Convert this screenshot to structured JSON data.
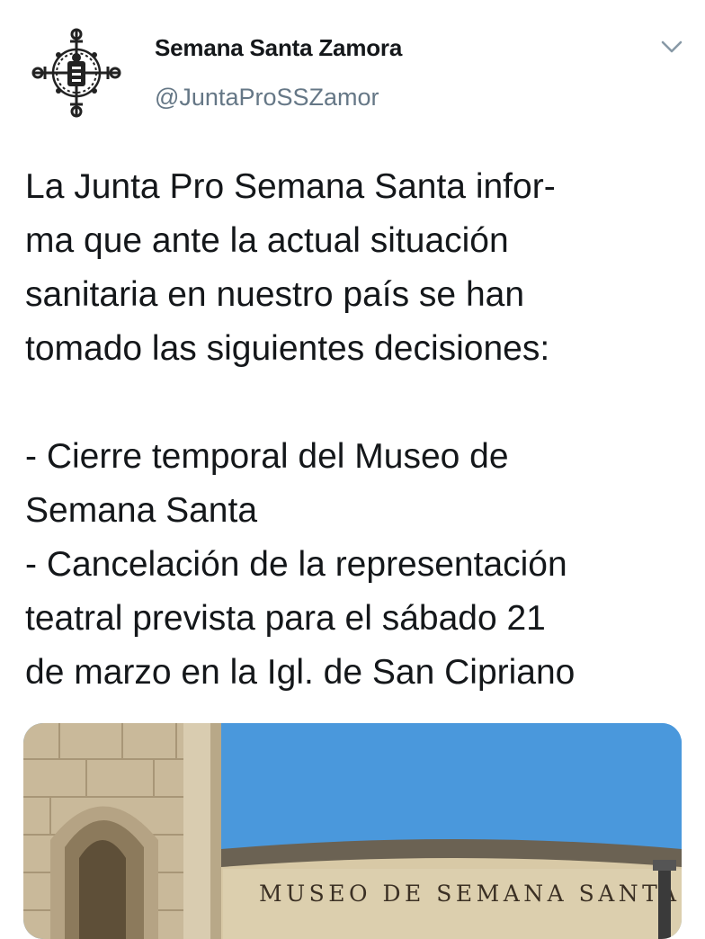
{
  "account": {
    "display_name": "Semana Santa Zamora",
    "handle": "@JuntaProSSZamor",
    "avatar_icon": "cross-emblem-icon",
    "menu_icon": "chevron-down-icon"
  },
  "tweet": {
    "lines": [
      "La Junta Pro Semana Santa infor-",
      "ma que ante la actual situación",
      "sanitaria en nuestro país se han",
      "tomado las siguientes decisiones:",
      "",
      "- Cierre temporal del Museo de",
      "Semana Santa",
      "- Cancelación de la representación",
      "teatral prevista para el sábado 21",
      "de marzo en la Igl. de San Cipriano"
    ]
  },
  "media": {
    "sign_text": "MUSEO DE SEMANA SANTA"
  },
  "colors": {
    "text": "#14171a",
    "secondary": "#657786",
    "sky": "#3f8fd6"
  }
}
